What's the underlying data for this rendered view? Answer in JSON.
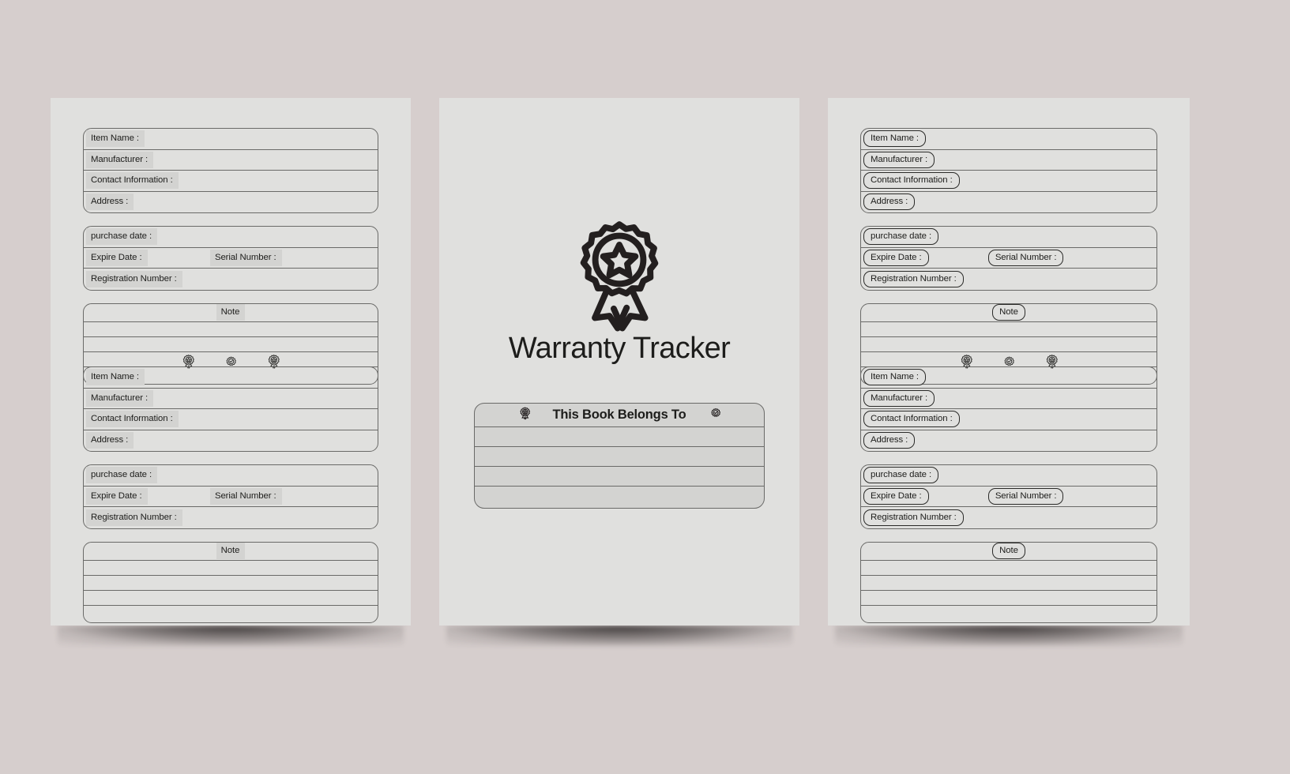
{
  "background_color": "#d6cecd",
  "paper_color": "#e0e0de",
  "field_fill_color": "#d3d3d1",
  "line_color": "#6a6a68",
  "text_color": "#1d1d1b",
  "cover": {
    "badge_icon": "award-ribbon-badge-icon",
    "title": "Warranty Tracker",
    "belongs_box": {
      "title": "This Book Belongs To",
      "left_icon": "award-ribbon-badge-icon",
      "right_icon": "check-circle-seal-icon",
      "line_count": 4
    }
  },
  "form": {
    "contact_fields": [
      {
        "label": "Item Name :"
      },
      {
        "label": "Manufacturer :"
      },
      {
        "label": "Contact Information :"
      },
      {
        "label": "Address :"
      }
    ],
    "warranty_fields": [
      {
        "label": "purchase date :"
      },
      {
        "label": "Expire Date :",
        "inline_label": "Serial Number :"
      },
      {
        "label": "Registration Number :"
      }
    ],
    "note": {
      "heading": "Note",
      "line_count": 4
    }
  },
  "divider_icons": [
    "award-ribbon-badge-icon",
    "check-circle-seal-icon",
    "award-ribbon-badge-icon"
  ],
  "pages": [
    {
      "name": "left-interior-page",
      "label_style": "highlight"
    },
    {
      "name": "cover-page",
      "label_style": "cover"
    },
    {
      "name": "right-interior-page",
      "label_style": "pill"
    }
  ]
}
